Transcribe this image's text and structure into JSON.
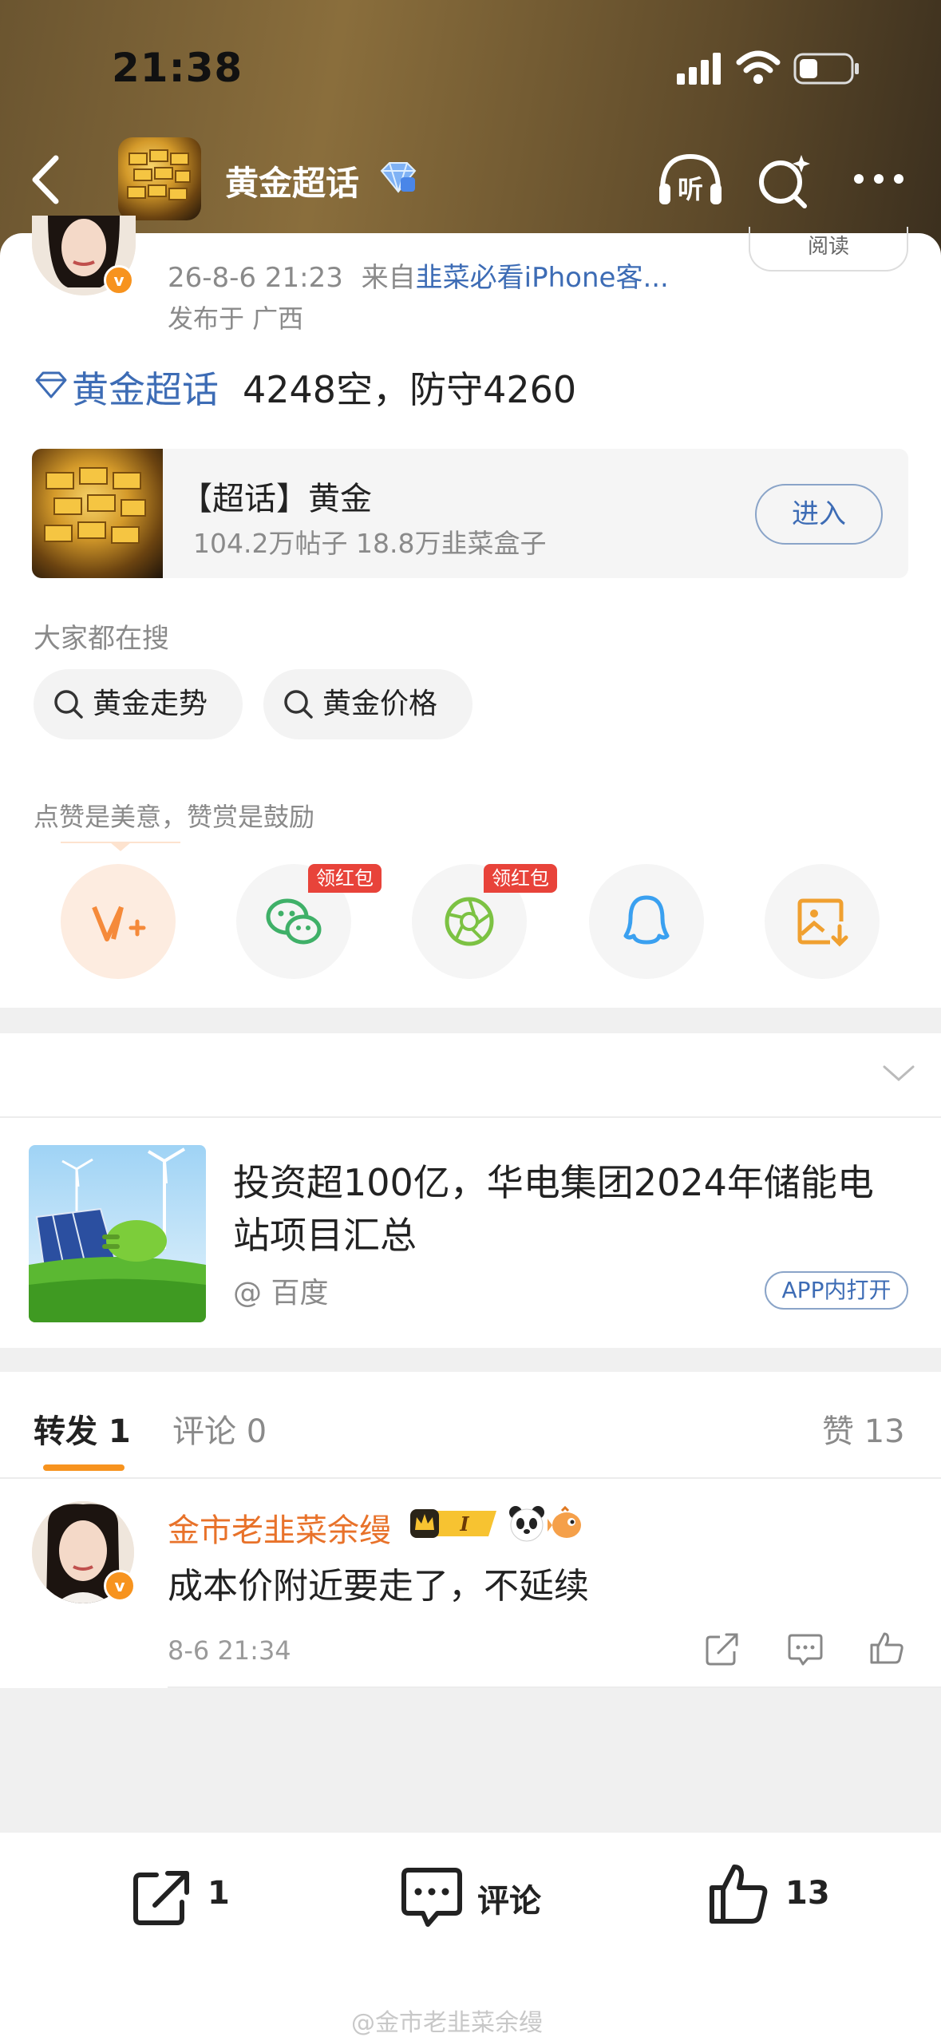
{
  "status_bar": {
    "time": "21:38"
  },
  "header": {
    "title": "黄金超话"
  },
  "post": {
    "read_label": "阅读",
    "meta_date": "26-8-6 21:23",
    "meta_from": "来自",
    "meta_source": "韭菜必看iPhone客...",
    "location": "发布于 广西",
    "topic_link": "黄金超话",
    "text": "4248空，防守4260"
  },
  "topic_card": {
    "title": "【超话】黄金",
    "stats": "104.2万帖子 18.8万韭菜盒子",
    "enter_label": "进入"
  },
  "search": {
    "heading": "大家都在搜",
    "chips": [
      "黄金走势",
      "黄金价格"
    ]
  },
  "like_section": {
    "heading": "点赞是美意，赞赏是鼓励",
    "redpack_label": "领红包"
  },
  "ad": {
    "title": "投资超100亿，华电集团2024年储能电站项目汇总",
    "source": "@ 百度",
    "app_open_label": "APP内打开"
  },
  "tabs": {
    "repost": "转发 1",
    "comment": "评论 0",
    "like": "赞 13"
  },
  "comment": {
    "username": "金市老韭菜余缦",
    "text": "成本价附近要走了，不延续",
    "time": "8-6 21:34"
  },
  "bottom_bar": {
    "repost_count": "1",
    "comment_label": "评论",
    "like_count": "13"
  },
  "watermark": "@金市老韭菜余缦",
  "colors": {
    "accent_orange": "#f7931e",
    "link_blue": "#3d6cb5",
    "username_orange": "#e8722a",
    "redpack_red": "#e8433a"
  }
}
